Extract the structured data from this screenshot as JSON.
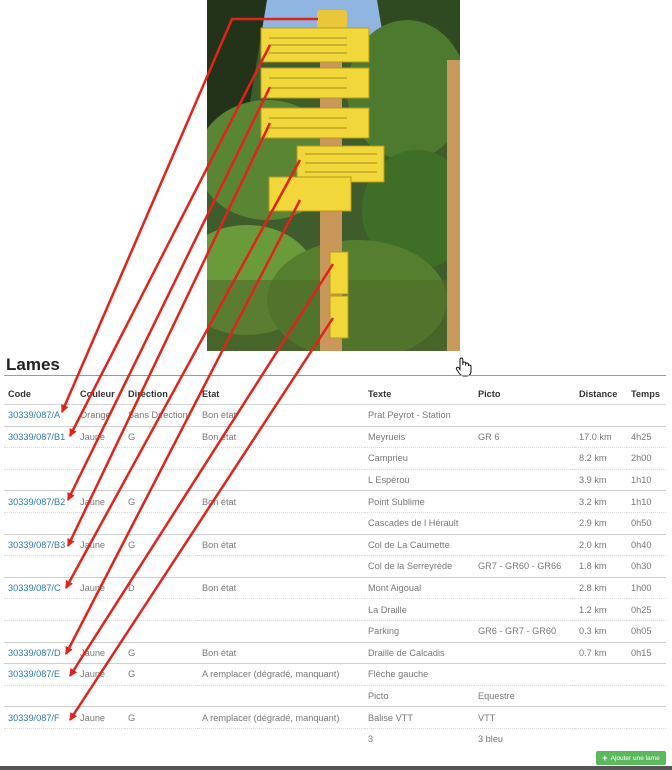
{
  "section_title": "Lames",
  "columns": [
    "Code",
    "Couleur",
    "Direction",
    "Etat",
    "Texte",
    "Picto",
    "Distance",
    "Temps"
  ],
  "rows": [
    {
      "group": true,
      "code": "30339/087/A",
      "couleur": "Orange",
      "direction": "Sans Direction",
      "etat": "Bon état",
      "texte": "Prat Peyrot - Station",
      "picto": "",
      "distance": "",
      "temps": ""
    },
    {
      "group": true,
      "code": "30339/087/B1",
      "couleur": "Jaune",
      "direction": "G",
      "etat": "Bon état",
      "texte": "Meyrueis",
      "picto": "GR 6",
      "distance": "17.0 km",
      "temps": "4h25"
    },
    {
      "group": false,
      "code": "",
      "couleur": "",
      "direction": "",
      "etat": "",
      "texte": "Camprieu",
      "picto": "",
      "distance": "8.2 km",
      "temps": "2h00"
    },
    {
      "group": false,
      "code": "",
      "couleur": "",
      "direction": "",
      "etat": "",
      "texte": "L Espérou",
      "picto": "",
      "distance": "3.9 km",
      "temps": "1h10"
    },
    {
      "group": true,
      "code": "30339/087/B2",
      "couleur": "Jaune",
      "direction": "G",
      "etat": "Bon état",
      "texte": "Point Sublime",
      "picto": "",
      "distance": "3.2 km",
      "temps": "1h10"
    },
    {
      "group": false,
      "code": "",
      "couleur": "",
      "direction": "",
      "etat": "",
      "texte": "Cascades de l Hérault",
      "picto": "",
      "distance": "2.9 km",
      "temps": "0h50"
    },
    {
      "group": true,
      "code": "30339/087/B3",
      "couleur": "Jaune",
      "direction": "G",
      "etat": "Bon état",
      "texte": "Col de La Caumette",
      "picto": "",
      "distance": "2.0 km",
      "temps": "0h40"
    },
    {
      "group": false,
      "code": "",
      "couleur": "",
      "direction": "",
      "etat": "",
      "texte": "Col de la Serreyrède",
      "picto": "GR7 - GR60 - GR66",
      "distance": "1.8 km",
      "temps": "0h30"
    },
    {
      "group": true,
      "code": "30339/087/C",
      "couleur": "Jaune",
      "direction": "D",
      "etat": "Bon état",
      "texte": "Mont Aigoual",
      "picto": "",
      "distance": "2.8 km",
      "temps": "1h00"
    },
    {
      "group": false,
      "code": "",
      "couleur": "",
      "direction": "",
      "etat": "",
      "texte": "La Draille",
      "picto": "",
      "distance": "1.2 km",
      "temps": "0h25"
    },
    {
      "group": false,
      "code": "",
      "couleur": "",
      "direction": "",
      "etat": "",
      "texte": "Parking",
      "picto": "GR6 - GR7 - GR60",
      "distance": "0.3 km",
      "temps": "0h05"
    },
    {
      "group": true,
      "code": "30339/087/D",
      "couleur": "Jaune",
      "direction": "G",
      "etat": "Bon état",
      "texte": "Draille de Calcadis",
      "picto": "",
      "distance": "0.7 km",
      "temps": "0h15"
    },
    {
      "group": true,
      "code": "30339/087/E",
      "couleur": "Jaune",
      "direction": "G",
      "etat": "A remplacer (dégradé, manquant)",
      "texte": "Flèche gauche",
      "picto": "",
      "distance": "",
      "temps": ""
    },
    {
      "group": false,
      "code": "",
      "couleur": "",
      "direction": "",
      "etat": "",
      "texte": "Picto",
      "picto": "Equestre",
      "distance": "",
      "temps": ""
    },
    {
      "group": true,
      "code": "30339/087/F",
      "couleur": "Jaune",
      "direction": "G",
      "etat": "A remplacer (dégradé, manquant)",
      "texte": "Balise VTT",
      "picto": "VTT",
      "distance": "",
      "temps": ""
    },
    {
      "group": false,
      "code": "",
      "couleur": "",
      "direction": "",
      "etat": "",
      "texte": "3",
      "picto": "3 bleu",
      "distance": "",
      "temps": ""
    }
  ],
  "add_button_label": "Ajouter une lame",
  "colors": {
    "link": "#2a7ab0",
    "arrow": "#e0231b",
    "button": "#5cb85c",
    "sign": "#f2d73a"
  },
  "icons": {
    "cursor": "hand-cursor-icon",
    "add": "plus-icon",
    "arrow": "arrow-annotation"
  }
}
